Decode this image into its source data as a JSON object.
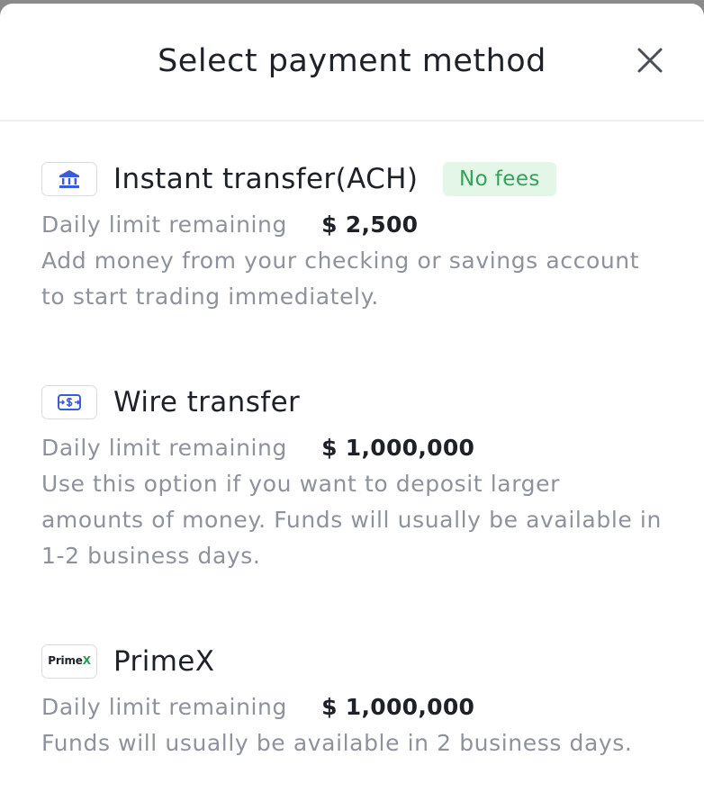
{
  "modal": {
    "title": "Select payment method"
  },
  "methods": [
    {
      "name": "Instant transfer(ACH)",
      "badge": "No fees",
      "icon": "bank-icon",
      "limit_label": "Daily limit remaining",
      "limit_value": "$ 2,500",
      "description": "Add money from your checking or savings account to start trading immediately."
    },
    {
      "name": "Wire transfer",
      "icon": "money-transfer-icon",
      "limit_label": "Daily limit remaining",
      "limit_value": "$ 1,000,000",
      "description": "Use this option if you want to deposit larger amounts of money. Funds will usually be available in 1-2 business days."
    },
    {
      "name": "PrimeX",
      "icon": "primex-logo",
      "logo_text": "Prime",
      "logo_mark": "X",
      "limit_label": "Daily limit remaining",
      "limit_value": "$ 1,000,000",
      "description": "Funds will usually be available in 2 business days."
    }
  ],
  "colors": {
    "accent_blue": "#3b5bdb",
    "badge_bg": "#e3f6e8",
    "badge_text": "#36a259",
    "primary_text": "#1e2128",
    "secondary_text": "#8d929b"
  }
}
